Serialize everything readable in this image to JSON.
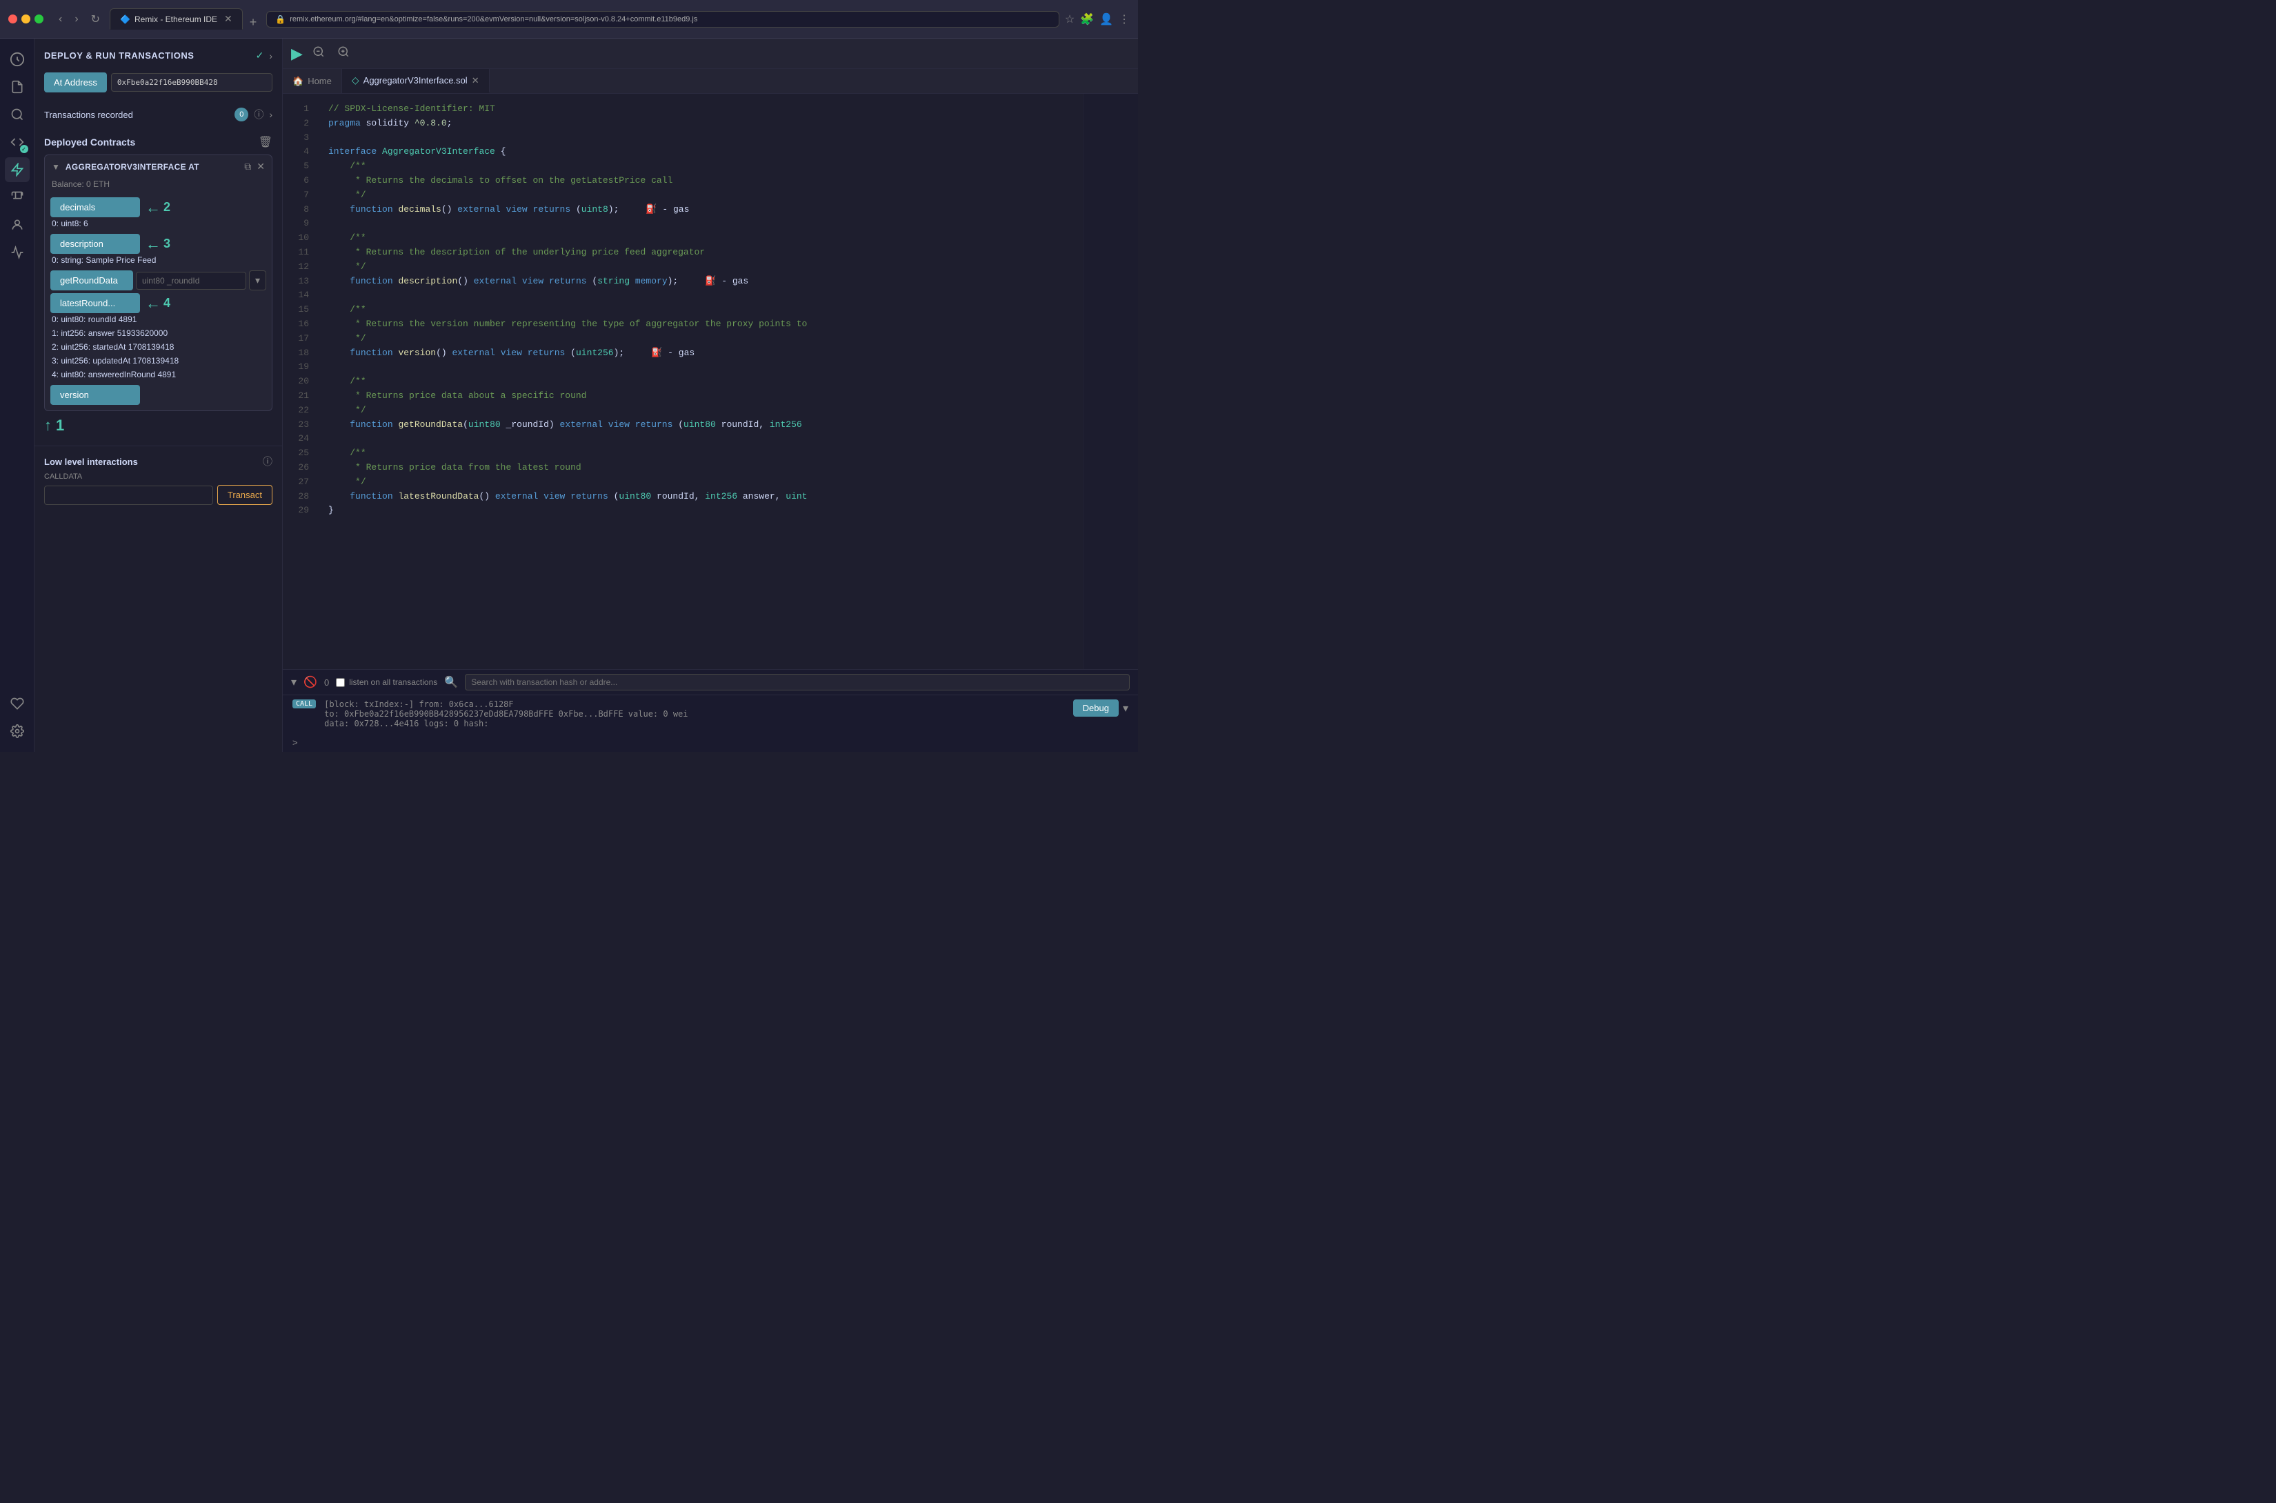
{
  "browser": {
    "tab_title": "Remix - Ethereum IDE",
    "url": "remix.ethereum.org/#lang=en&optimize=false&runs=200&evmVersion=null&version=soljson-v0.8.24+commit.e11b9ed9.js",
    "tab_icon": "🔷"
  },
  "panel": {
    "title": "DEPLOY & RUN TRANSACTIONS",
    "at_address_label": "At Address",
    "at_address_value": "0xFbe0a22f16eB990BB428",
    "transactions_label": "Transactions recorded",
    "transactions_count": "0",
    "deployed_label": "Deployed Contracts",
    "contract_name": "AGGREGATORV3INTERFACE AT",
    "contract_balance": "Balance: 0 ETH",
    "low_level_title": "Low level interactions",
    "calldata_label": "CALLDATA",
    "transact_label": "Transact"
  },
  "functions": [
    {
      "label": "decimals",
      "result": "0: uint8: 6"
    },
    {
      "label": "description",
      "result": "0: string: Sample Price Feed"
    },
    {
      "label": "getRoundData",
      "placeholder": "uint80 _roundId",
      "has_input": true
    },
    {
      "label": "latestRound...",
      "results": [
        "0: uint80: roundId 4891",
        "1: int256: answer 51933620000",
        "2: uint256: startedAt 1708139418",
        "3: uint256: updatedAt 1708139418",
        "4: uint80: answeredInRound 4891"
      ]
    },
    {
      "label": "version"
    }
  ],
  "annotations": [
    {
      "num": "1",
      "arrow": "←"
    },
    {
      "num": "2",
      "arrow": "←"
    },
    {
      "num": "3",
      "arrow": "←"
    },
    {
      "num": "4",
      "arrow": "←"
    }
  ],
  "code": {
    "filename": "AggregatorV3Interface.sol",
    "lines": [
      {
        "n": 1,
        "code": "// SPDX-License-Identifier: MIT",
        "type": "comment"
      },
      {
        "n": 2,
        "code": "pragma solidity ^0.8.0;",
        "type": "mixed"
      },
      {
        "n": 3,
        "code": "",
        "type": "plain"
      },
      {
        "n": 4,
        "code": "interface AggregatorV3Interface {",
        "type": "mixed"
      },
      {
        "n": 5,
        "code": "    /**",
        "type": "comment"
      },
      {
        "n": 6,
        "code": "     * Returns the decimals to offset on the getLatestPrice call",
        "type": "comment"
      },
      {
        "n": 7,
        "code": "     */",
        "type": "comment"
      },
      {
        "n": 8,
        "code": "    function decimals() external view returns (uint8);     ⛽ - gas",
        "type": "mixed"
      },
      {
        "n": 9,
        "code": "",
        "type": "plain"
      },
      {
        "n": 10,
        "code": "    /**",
        "type": "comment"
      },
      {
        "n": 11,
        "code": "     * Returns the description of the underlying price feed aggregator",
        "type": "comment"
      },
      {
        "n": 12,
        "code": "     */",
        "type": "comment"
      },
      {
        "n": 13,
        "code": "    function description() external view returns (string memory);     ⛽ - gas",
        "type": "mixed"
      },
      {
        "n": 14,
        "code": "",
        "type": "plain"
      },
      {
        "n": 15,
        "code": "    /**",
        "type": "comment"
      },
      {
        "n": 16,
        "code": "     * Returns the version number representing the type of aggregator the proxy points to",
        "type": "comment"
      },
      {
        "n": 17,
        "code": "     */",
        "type": "comment"
      },
      {
        "n": 18,
        "code": "    function version() external view returns (uint256);     ⛽ - gas",
        "type": "mixed"
      },
      {
        "n": 19,
        "code": "",
        "type": "plain"
      },
      {
        "n": 20,
        "code": "    /**",
        "type": "comment"
      },
      {
        "n": 21,
        "code": "     * Returns price data about a specific round",
        "type": "comment"
      },
      {
        "n": 22,
        "code": "     */",
        "type": "comment"
      },
      {
        "n": 23,
        "code": "    function getRoundData(uint80 _roundId) external view returns (uint80 roundId, int256",
        "type": "mixed"
      },
      {
        "n": 24,
        "code": "",
        "type": "plain"
      },
      {
        "n": 25,
        "code": "    /**",
        "type": "comment"
      },
      {
        "n": 26,
        "code": "     * Returns price data from the latest round",
        "type": "comment"
      },
      {
        "n": 27,
        "code": "     */",
        "type": "comment"
      },
      {
        "n": 28,
        "code": "    function latestRoundData() external view returns (uint80 roundId, int256 answer, uint",
        "type": "mixed"
      },
      {
        "n": 29,
        "code": "}",
        "type": "plain"
      }
    ]
  },
  "console": {
    "count": "0",
    "listen_label": "listen on all transactions",
    "search_placeholder": "Search with transaction hash or addre...",
    "log_text": "[block: txIndex:-] from: 0x6ca...6128F",
    "log_to": "to: 0xFbe0a22f16eB990BB428956237eDd8EA798BdFFE 0xFbe...BdFFE value: 0 wei",
    "log_data": "data: 0x728...4e416 logs: 0 hash:",
    "debug_label": "Debug",
    "call_label": "CALL",
    "prompt": ">"
  },
  "rail_icons": [
    {
      "icon": "🏠",
      "name": "home"
    },
    {
      "icon": "📄",
      "name": "files"
    },
    {
      "icon": "🔍",
      "name": "search"
    },
    {
      "icon": "⚙️",
      "name": "compiler",
      "badge": true
    },
    {
      "icon": "🚀",
      "name": "deploy",
      "active": true
    },
    {
      "icon": "🧪",
      "name": "testing"
    },
    {
      "icon": "👤",
      "name": "profile"
    },
    {
      "icon": "📊",
      "name": "analytics"
    }
  ]
}
